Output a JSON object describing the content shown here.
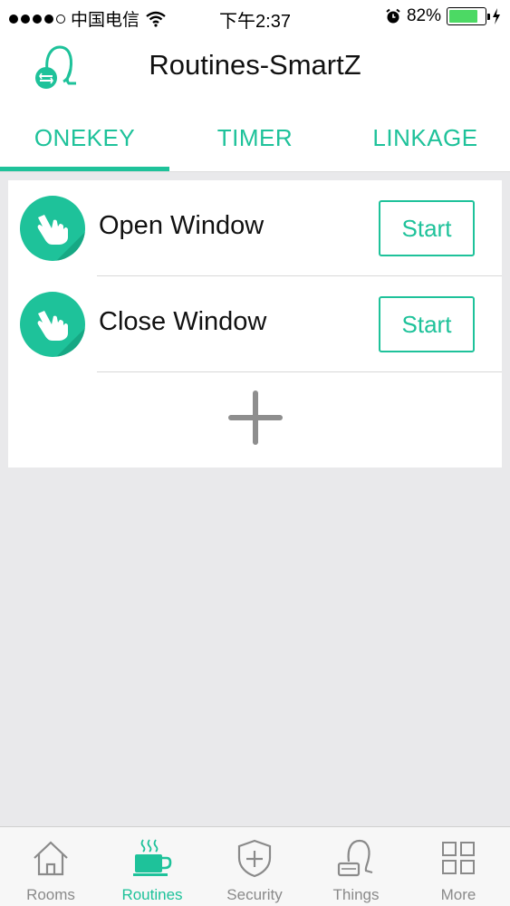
{
  "status_bar": {
    "carrier": "中国电信",
    "time": "下午2:37",
    "battery_percent": "82%",
    "battery_level": 0.82,
    "signal_bars_filled": 4,
    "signal_bars_total": 5
  },
  "header": {
    "title": "Routines-SmartZ",
    "app_icon": "vacuum-cleaner-icon"
  },
  "tabs": [
    {
      "label": "ONEKEY",
      "active": true
    },
    {
      "label": "TIMER",
      "active": false
    },
    {
      "label": "LINKAGE",
      "active": false
    }
  ],
  "routines": [
    {
      "name": "Open Window",
      "icon": "hand-pointer-icon",
      "action_label": "Start"
    },
    {
      "name": "Close Window",
      "icon": "hand-pointer-icon",
      "action_label": "Start"
    }
  ],
  "add_button_icon": "plus-icon",
  "bottom_nav": [
    {
      "label": "Rooms",
      "icon": "house-icon",
      "active": false
    },
    {
      "label": "Routines",
      "icon": "coffee-cup-icon",
      "active": true
    },
    {
      "label": "Security",
      "icon": "shield-plus-icon",
      "active": false
    },
    {
      "label": "Things",
      "icon": "vacuum-icon",
      "active": false
    },
    {
      "label": "More",
      "icon": "grid-icon",
      "active": false
    }
  ],
  "colors": {
    "accent": "#1ec29a",
    "background": "#e9e9eb",
    "inactive_nav": "#8a8a8a"
  }
}
